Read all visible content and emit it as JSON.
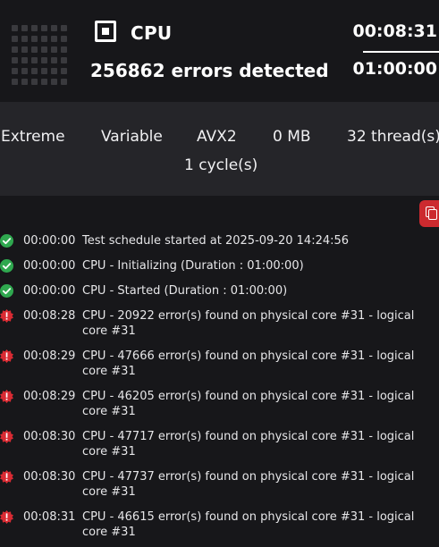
{
  "header": {
    "title": "CPU",
    "errors_text": "256862 errors detected",
    "elapsed": "00:08:31",
    "duration": "01:00:00"
  },
  "settings": {
    "mode": "Extreme",
    "load": "Variable",
    "instruction_set": "AVX2",
    "memory": "0 MB",
    "threads": "32 thread(s)",
    "cycles": "1 cycle(s)"
  },
  "colors": {
    "success": "#2fa84f",
    "error": "#d92b33",
    "accent": "#cc2a2f"
  },
  "log": [
    {
      "status": "success",
      "icon": "check-circle-icon",
      "time": "00:00:00",
      "message": "Test schedule started at 2025-09-20 14:24:56"
    },
    {
      "status": "success",
      "icon": "check-circle-icon",
      "time": "00:00:00",
      "message": "CPU - Initializing (Duration : 01:00:00)"
    },
    {
      "status": "success",
      "icon": "check-circle-icon",
      "time": "00:00:00",
      "message": "CPU - Started (Duration : 01:00:00)"
    },
    {
      "status": "error",
      "icon": "error-badge-icon",
      "time": "00:08:28",
      "message": "CPU - 20922 error(s) found on physical core #31 - logical core #31"
    },
    {
      "status": "error",
      "icon": "error-badge-icon",
      "time": "00:08:29",
      "message": "CPU - 47666 error(s) found on physical core #31 - logical core #31"
    },
    {
      "status": "error",
      "icon": "error-badge-icon",
      "time": "00:08:29",
      "message": "CPU - 46205 error(s) found on physical core #31 - logical core #31"
    },
    {
      "status": "error",
      "icon": "error-badge-icon",
      "time": "00:08:30",
      "message": "CPU - 47717 error(s) found on physical core #31 - logical core #31"
    },
    {
      "status": "error",
      "icon": "error-badge-icon",
      "time": "00:08:30",
      "message": "CPU - 47737 error(s) found on physical core #31 - logical core #31"
    },
    {
      "status": "error",
      "icon": "error-badge-icon",
      "time": "00:08:31",
      "message": "CPU - 46615 error(s) found on physical core #31 - logical core #31"
    }
  ]
}
